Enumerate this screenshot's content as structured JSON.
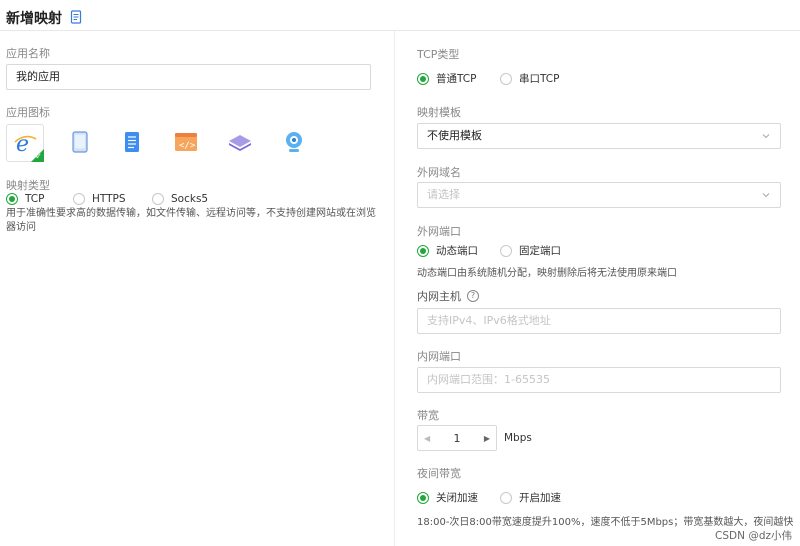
{
  "header": {
    "title": "新增映射"
  },
  "left": {
    "app_name_label": "应用名称",
    "app_name_value": "我的应用",
    "app_icon_label": "应用图标",
    "icons": [
      "ie-browser-icon",
      "tablet-icon",
      "document-server-icon",
      "code-window-icon",
      "layers-icon",
      "webcam-icon"
    ],
    "mapping_type_label": "映射类型",
    "mapping_types": [
      {
        "label": "TCP",
        "selected": true
      },
      {
        "label": "HTTPS",
        "selected": false
      },
      {
        "label": "Socks5",
        "selected": false
      }
    ],
    "mapping_help": "用于准确性要求高的数据传输，如文件传输、远程访问等，不支持创建网站或在浏览器访问"
  },
  "right": {
    "tcp_type_label": "TCP类型",
    "tcp_types": [
      {
        "label": "普通TCP",
        "selected": true
      },
      {
        "label": "串口TCP",
        "selected": false
      }
    ],
    "template_label": "映射模板",
    "template_value": "不使用模板",
    "domain_label": "外网域名",
    "domain_placeholder": "请选择",
    "ext_port_label": "外网端口",
    "ext_port_options": [
      {
        "label": "动态端口",
        "selected": true
      },
      {
        "label": "固定端口",
        "selected": false
      }
    ],
    "ext_port_help": "动态端口由系统随机分配，映射删除后将无法使用原来端口",
    "host_label": "内网主机",
    "host_placeholder": "支持IPv4、IPv6格式地址",
    "inner_port_label": "内网端口",
    "inner_port_placeholder": "内网端口范围：1-65535",
    "bandwidth_label": "带宽",
    "bandwidth_value": "1",
    "bandwidth_unit": "Mbps",
    "night_label": "夜间带宽",
    "night_options": [
      {
        "label": "关闭加速",
        "selected": true
      },
      {
        "label": "开启加速",
        "selected": false
      }
    ],
    "night_help": "18:00-次日8:00带宽速度提升100%，速度不低于5Mbps；带宽基数越大，夜间越快"
  },
  "watermark": "CSDN @dz小伟",
  "colors": {
    "accent": "#21a73b",
    "border": "#d9d9d9"
  }
}
